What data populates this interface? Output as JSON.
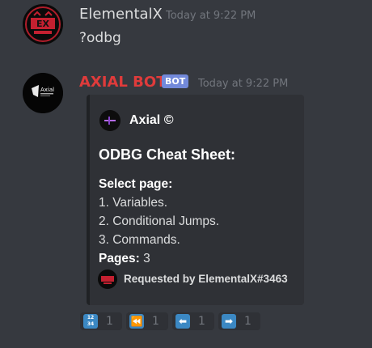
{
  "messages": [
    {
      "username": "ElementalX",
      "timestamp": "Today at 9:22 PM",
      "content": "?odbg",
      "username_color": "#dcddde"
    },
    {
      "username": "AXIAL BOT",
      "bot_tag": "BOT",
      "timestamp": "Today at 9:22 PM",
      "username_color": "#e03b3b",
      "embed": {
        "author": "Axial ©",
        "title": "ODBG Cheat Sheet:",
        "desc_label": "Select page:",
        "lines": [
          "1. Variables.",
          "2. Conditional Jumps.",
          "3. Commands."
        ],
        "pages_label": "Pages:",
        "pages_value": "3",
        "footer": "Requested by ElementalX#3463"
      },
      "reactions": [
        {
          "icon": "numbers-icon",
          "emoji": "1234",
          "count": "1"
        },
        {
          "icon": "rewind-icon",
          "emoji": "⏪",
          "count": "1"
        },
        {
          "icon": "left-arrow-icon",
          "emoji": "⬅",
          "count": "1"
        },
        {
          "icon": "right-arrow-icon",
          "emoji": "➡",
          "count": "1"
        }
      ]
    }
  ],
  "colors": {
    "background": "#36393f",
    "embed_bg": "#2f3136",
    "bot_tag": "#7289da",
    "reaction_emoji_bg": "#3b88c3"
  }
}
